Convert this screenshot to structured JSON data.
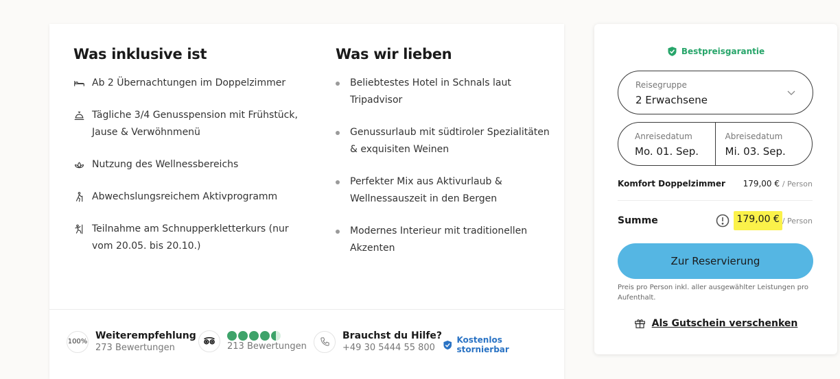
{
  "included": {
    "heading": "Was inklusive ist",
    "items": [
      {
        "icon": "bed-icon",
        "text": "Ab 2 Übernachtungen im Doppelzimmer"
      },
      {
        "icon": "meal-icon",
        "text": "Tägliche 3/4 Genusspension mit Frühstück, Jause & Verwöhnmenü"
      },
      {
        "icon": "lotus-icon",
        "text": "Nutzung des Wellnessbereichs"
      },
      {
        "icon": "hiking-icon",
        "text": "Abwechslungsreichem Aktivprogramm"
      },
      {
        "icon": "climbing-icon",
        "text": "Teilnahme am Schnupperkletterkurs (nur vom 20.05. bis 20.10.)"
      }
    ]
  },
  "loved": {
    "heading": "Was wir lieben",
    "items": [
      "Beliebtestes Hotel in Schnals laut Tripadvisor",
      "Genussurlaub mit südtiroler Spezialitäten & exquisiten Weinen",
      "Perfekter Mix aus Aktivurlaub & Wellnessauszeit in den Bergen",
      "Modernes Interieur mit traditionellen Akzenten"
    ]
  },
  "footer": {
    "recommend_badge": "100%",
    "recommend_title": "Weiterempfehlung",
    "recommend_sub": "273 Bewertungen",
    "tripadvisor_rating": 4.5,
    "tripadvisor_sub": "213 Bewertungen",
    "help_title": "Brauchst du Hilfe?",
    "help_phone": "+49 30 5444 55 800",
    "storno": "Kostenlos stornierbar"
  },
  "booking": {
    "best_price": "Bestpreisgarantie",
    "group_label": "Reisegruppe",
    "group_value": "2 Erwachsene",
    "arrival_label": "Anreisedatum",
    "arrival_value": "Mo. 01. Sep.",
    "departure_label": "Abreisedatum",
    "departure_value": "Mi. 03. Sep.",
    "room_name": "Komfort Doppelzimmer",
    "room_price": "179,00 €",
    "per_person": "/ Person",
    "sum_label": "Summe",
    "sum_price": "179,00 €",
    "reserve_button": "Zur Reservierung",
    "price_note": "Preis pro Person inkl. aller ausgewählter Leistungen pro Aufenthalt.",
    "voucher": "Als Gutschein verschenken"
  },
  "colors": {
    "green": "#27a56a",
    "blue_link": "#2a73c4",
    "button": "#55b6e3",
    "highlight": "#fbf24a"
  }
}
